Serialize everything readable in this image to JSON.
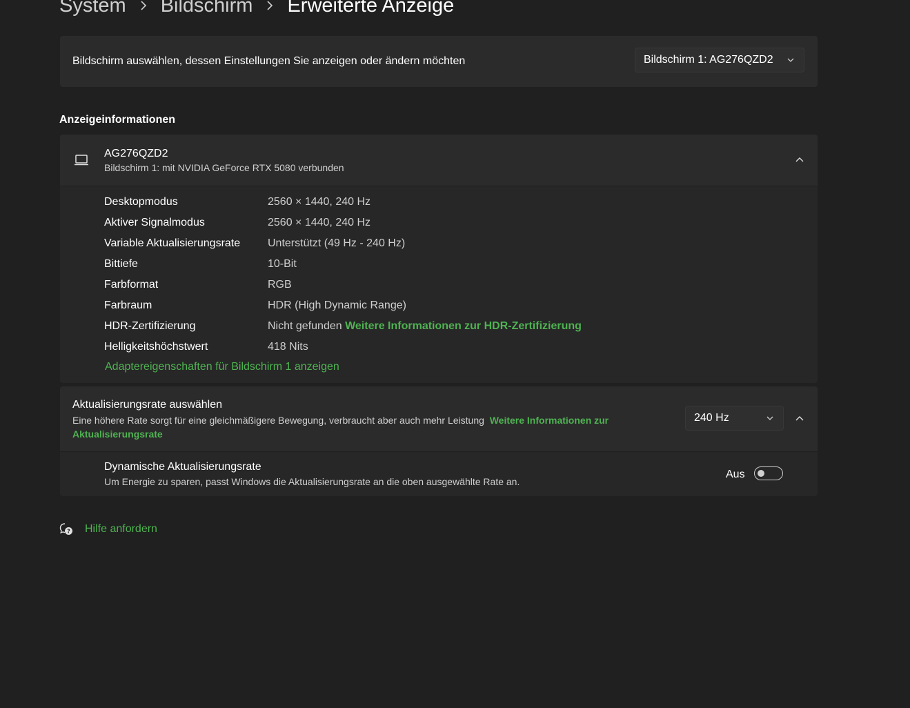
{
  "breadcrumb": {
    "items": [
      "System",
      "Bildschirm"
    ],
    "current": "Erweiterte Anzeige"
  },
  "select_display": {
    "label": "Bildschirm auswählen, dessen Einstellungen Sie anzeigen oder ändern möchten",
    "selected": "Bildschirm 1: AG276QZD2"
  },
  "display_info": {
    "section_title": "Anzeigeinformationen",
    "name": "AG276QZD2",
    "connection": "Bildschirm 1: mit NVIDIA GeForce RTX 5080 verbunden",
    "rows": [
      {
        "key": "Desktopmodus",
        "value": "2560 × 1440, 240 Hz"
      },
      {
        "key": "Aktiver Signalmodus",
        "value": "2560 × 1440, 240 Hz"
      },
      {
        "key": "Variable Aktualisierungsrate",
        "value": "Unterstützt (49 Hz - 240 Hz)"
      },
      {
        "key": "Bittiefe",
        "value": "10-Bit"
      },
      {
        "key": "Farbformat",
        "value": "RGB"
      },
      {
        "key": "Farbraum",
        "value": "HDR (High Dynamic Range)"
      },
      {
        "key": "HDR-Zertifizierung",
        "value": "Nicht gefunden",
        "link": "Weitere Informationen zur HDR-Zertifizierung"
      },
      {
        "key": "Helligkeitshöchstwert",
        "value": "418 Nits"
      }
    ],
    "adapter_link": "Adaptereigenschaften für Bildschirm 1 anzeigen"
  },
  "refresh_rate": {
    "title": "Aktualisierungsrate auswählen",
    "description": "Eine höhere Rate sorgt für eine gleichmäßigere Bewegung, verbraucht aber auch mehr Leistung",
    "link": "Weitere Informationen zur Aktualisierungsrate",
    "selected": "240 Hz"
  },
  "dynamic_refresh": {
    "title": "Dynamische Aktualisierungsrate",
    "description": "Um Energie zu sparen, passt Windows die Aktualisierungsrate an die oben ausgewählte Rate an.",
    "state_label": "Aus",
    "enabled": false
  },
  "help": {
    "label": "Hilfe anfordern"
  },
  "colors": {
    "accent": "#4fb352",
    "background": "#202020",
    "card": "#2b2b2b"
  },
  "icons": {
    "display": "laptop-icon",
    "help": "help-chat-icon",
    "chevron": "chevron-icon"
  }
}
